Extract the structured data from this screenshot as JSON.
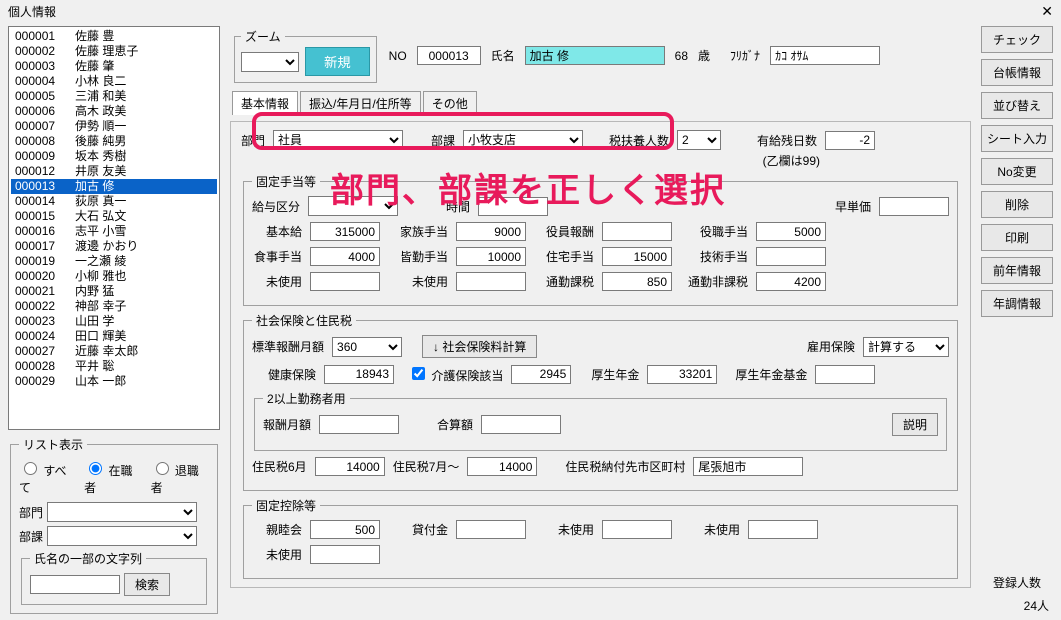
{
  "window_title": "個人情報",
  "close_glyph": "✕",
  "zoom_label": "ズーム",
  "new_button": "新規",
  "no_label": "NO",
  "no_value": "000013",
  "name_label": "氏名",
  "name_value": "加古 修",
  "age_value": "68",
  "age_suffix": "歳",
  "furigana_label": "ﾌﾘｶﾞﾅ",
  "furigana_value": "ｶｺ ｵｻﾑ",
  "tabs": [
    "基本情報",
    "振込/年月日/住所等",
    "その他"
  ],
  "dept_label": "部門",
  "dept_value": "社員",
  "section_label": "部課",
  "section_value": "小牧支店",
  "dependents_label": "税扶養人数",
  "dependents_value": "2",
  "dependents_note": "(乙欄は99)",
  "paid_leave_label": "有給残日数",
  "paid_leave_value": "-2",
  "fixed_allow_legend": "固定手当等",
  "salary_class_label": "給与区分",
  "time_label": "時間",
  "unit_label": "早単価",
  "allow": {
    "base_lbl": "基本給",
    "base": "315000",
    "family_lbl": "家族手当",
    "family": "9000",
    "officer_lbl": "役員報酬",
    "officer": "",
    "job_lbl": "役職手当",
    "job": "5000",
    "meal_lbl": "食事手当",
    "meal": "4000",
    "attend_lbl": "皆勤手当",
    "attend": "10000",
    "house_lbl": "住宅手当",
    "house": "15000",
    "tech_lbl": "技術手当",
    "tech": "",
    "unused1_lbl": "未使用",
    "unused1": "",
    "unused2_lbl": "未使用",
    "unused2": "",
    "commute_tax_lbl": "通勤課税",
    "commute_tax": "850",
    "commute_notax_lbl": "通勤非課税",
    "commute_notax": "4200"
  },
  "ins_legend": "社会保険と住民税",
  "std_monthly_lbl": "標準報酬月額",
  "std_monthly": "360",
  "calc_ins_btn": "↓ 社会保険料計算",
  "emp_ins_lbl": "雇用保険",
  "emp_ins": "計算する",
  "health_lbl": "健康保険",
  "health": "18943",
  "nursing_chk_lbl": "介護保険該当",
  "nursing": "2945",
  "pension_lbl": "厚生年金",
  "pension": "33201",
  "pension_fund_lbl": "厚生年金基金",
  "pension_fund": "",
  "multi_legend": "2以上勤務者用",
  "multi_salary_lbl": "報酬月額",
  "multi_salary": "",
  "total_lbl": "合算額",
  "total": "",
  "explain_btn": "説明",
  "res6_lbl": "住民税6月",
  "res6": "14000",
  "res7_lbl": "住民税7月～",
  "res7": "14000",
  "res_city_lbl": "住民税納付先市区町村",
  "res_city": "尾張旭市",
  "deduct_legend": "固定控除等",
  "deduct": {
    "club_lbl": "親睦会",
    "club": "500",
    "loan_lbl": "貸付金",
    "loan": "",
    "u1_lbl": "未使用",
    "u1": "",
    "u2_lbl": "未使用",
    "u2": "",
    "u3_lbl": "未使用",
    "u3": ""
  },
  "list_filter_legend": "リスト表示",
  "filter_all": "すべて",
  "filter_active": "在職者",
  "filter_retired": "退職者",
  "filter_dept_lbl": "部門",
  "filter_sect_lbl": "部課",
  "name_search_legend": "氏名の一部の文字列",
  "search_btn": "検索",
  "right_buttons": [
    "チェック",
    "台帳情報",
    "並び替え",
    "シート入力",
    "No変更",
    "削除",
    "印刷",
    "前年情報",
    "年調情報"
  ],
  "reg_count_lbl": "登録人数",
  "reg_count": "24人",
  "overlay_text": "部門、部課を正しく選択",
  "employees": [
    {
      "id": "000001",
      "name": "佐藤 豊"
    },
    {
      "id": "000002",
      "name": "佐藤 理恵子"
    },
    {
      "id": "000003",
      "name": "佐藤 肇"
    },
    {
      "id": "000004",
      "name": "小林 良二"
    },
    {
      "id": "000005",
      "name": "三浦 和美"
    },
    {
      "id": "000006",
      "name": "高木 政美"
    },
    {
      "id": "000007",
      "name": "伊勢 順一"
    },
    {
      "id": "000008",
      "name": "後藤 純男"
    },
    {
      "id": "000009",
      "name": "坂本 秀樹"
    },
    {
      "id": "000012",
      "name": "井原 友美"
    },
    {
      "id": "000013",
      "name": "加古 修",
      "sel": true
    },
    {
      "id": "000014",
      "name": "荻原 真一"
    },
    {
      "id": "000015",
      "name": "大石 弘文"
    },
    {
      "id": "000016",
      "name": "志平 小雪"
    },
    {
      "id": "000017",
      "name": "渡邊 かおり"
    },
    {
      "id": "000019",
      "name": "一之瀬 綾"
    },
    {
      "id": "000020",
      "name": "小柳 雅也"
    },
    {
      "id": "000021",
      "name": "内野 猛"
    },
    {
      "id": "000022",
      "name": "神部 幸子"
    },
    {
      "id": "000023",
      "name": "山田 学"
    },
    {
      "id": "000024",
      "name": "田口 輝美"
    },
    {
      "id": "000027",
      "name": "近藤 幸太郎"
    },
    {
      "id": "000028",
      "name": "平井 聡"
    },
    {
      "id": "000029",
      "name": "山本 一郎"
    }
  ]
}
